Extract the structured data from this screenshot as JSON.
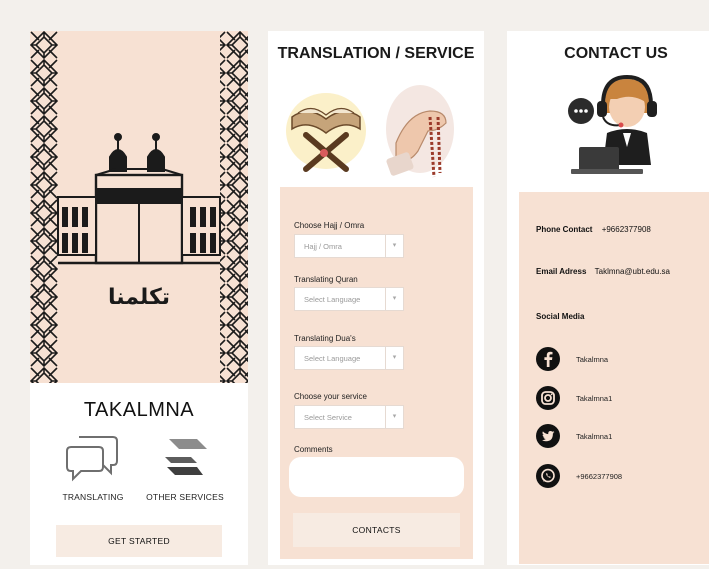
{
  "splash": {
    "arabic_title": "تكلمنا"
  },
  "home": {
    "brand": "TAKALMNA",
    "features": [
      {
        "label": "TRANSLATING",
        "icon": "chat-bubbles-icon"
      },
      {
        "label": "OTHER SERVICES",
        "icon": "hand-service-icon"
      }
    ],
    "get_started": "GET STARTED"
  },
  "translation": {
    "title": "TRANSLATION / SERVICE",
    "fields": [
      {
        "label": "Choose Hajj / Omra",
        "value": "Hajj / Omra"
      },
      {
        "label": "Translating Quran",
        "value": "Select Language"
      },
      {
        "label": "Translating Dua's",
        "value": "Select Language"
      },
      {
        "label": "Choose your service",
        "value": "Select Service"
      }
    ],
    "comments_label": "Comments",
    "contacts_button": "CONTACTS"
  },
  "contact": {
    "title": "CONTACT US",
    "phone_label": "Phone Contact",
    "phone_value": "+9662377908",
    "email_label": "Email Adress",
    "email_value": "Taklmna@ubt.edu.sa",
    "social_label": "Social Media",
    "social": [
      {
        "platform": "facebook-icon",
        "handle": "Takalmna"
      },
      {
        "platform": "instagram-icon",
        "handle": "Takalmna1"
      },
      {
        "platform": "twitter-icon",
        "handle": "Takalmna1"
      },
      {
        "platform": "whatsapp-icon",
        "handle": "+9662377908"
      }
    ]
  },
  "colors": {
    "peach": "#f7e1d3",
    "button": "#f7ebe2",
    "ink": "#1a1a1a"
  }
}
